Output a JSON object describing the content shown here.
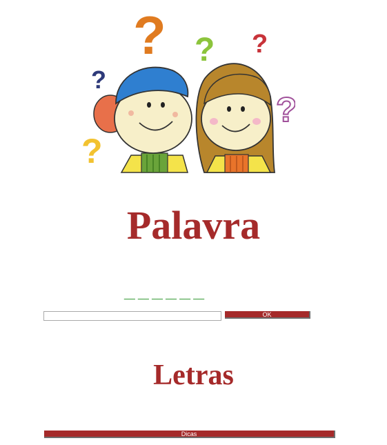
{
  "header": {
    "illustration": "two-kids-question-marks-illustration",
    "title": "Palavra"
  },
  "game": {
    "word_blanks": "__ __ __ __ __ __",
    "guess_input_value": "",
    "ok_label": "OK",
    "letters_title": "Letras",
    "hints_label": "Dicas"
  },
  "colors": {
    "accent": "#a52a2a",
    "blank_green": "#1a8c1a"
  }
}
